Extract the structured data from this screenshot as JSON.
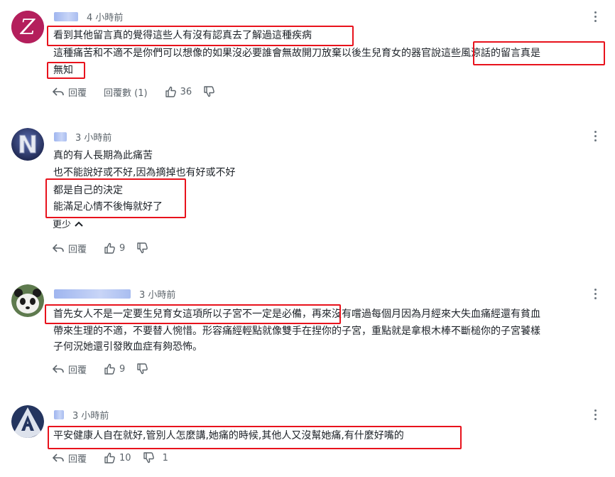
{
  "ui": {
    "reply_label": "回覆",
    "replies_count_label": "回覆數 (1)",
    "show_less_label": "更少",
    "colors": {
      "highlight_box": "#e8121c",
      "username_blur": "#9fb5ef",
      "z_avatar": "#b41f5c",
      "n_avatar": "#2e3a66",
      "a_avatar": "#24355f"
    }
  },
  "comments": [
    {
      "avatar_letter": "Z",
      "time": "4 小時前",
      "lines": [
        "看到其他留言真的覺得這些人有沒有認真去了解過這種疾病",
        "這種痛苦和不適不是你們可以想像的如果沒必要誰會無故開刀放棄以後生兒育女的器官說這些風涼話的留言真是",
        "無知"
      ],
      "likes": "36"
    },
    {
      "avatar_letter": "N",
      "time": "3 小時前",
      "lines": [
        "真的有人長期為此痛苦",
        "也不能說好或不好,因為摘掉也有好或不好",
        "都是自己的決定",
        "能滿足心情不後悔就好了"
      ],
      "likes": "9"
    },
    {
      "avatar_icon": "panda-avatar",
      "time": "3 小時前",
      "lines": [
        "首先女人不是一定要生兒育女這項所以子宮不一定是必備，再來沒有嚐過每個月因為月經來大失血痛經還有貧血",
        "帶來生理的不適，不要替人惋惜。形容痛經輕點就像雙手在捏你的子宮，重點就是拿根木棒不斷槌你的子宮饕樣",
        "子何況她還引發敗血症有夠恐怖。"
      ],
      "likes": "9"
    },
    {
      "avatar_letter": "A",
      "time": "3 小時前",
      "lines": [
        "平安健康人自在就好,管別人怎麼講,她痛的時候,其他人又沒幫她痛,有什麼好嘴的"
      ],
      "likes": "10",
      "dislikes": "1"
    }
  ]
}
